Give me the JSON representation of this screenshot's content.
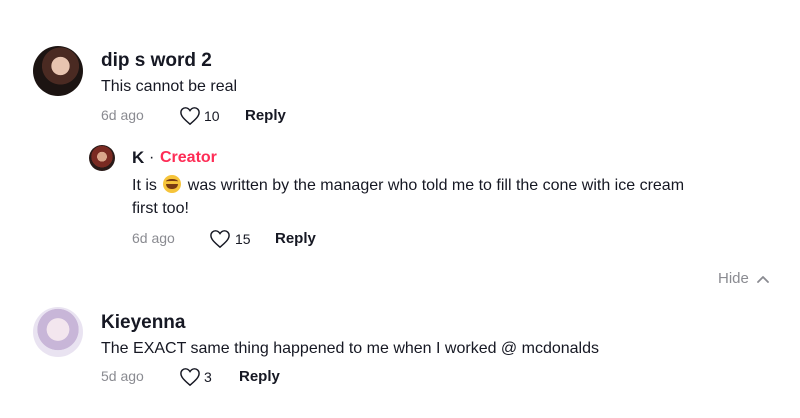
{
  "comments": [
    {
      "username": "dip s word 2",
      "text": "This cannot be real",
      "time": "6d ago",
      "likes": "10",
      "reply_label": "Reply"
    },
    {
      "username": "K",
      "separator": "·",
      "badge": "Creator",
      "text_before_emoji": "It is",
      "emoji_name": "laughing-tears-emoji",
      "text_after_emoji": "was written by the manager who told me to fill the cone with ice cream",
      "text_line2": "first too!",
      "time": "6d ago",
      "likes": "15",
      "reply_label": "Reply"
    },
    {
      "username": "Kieyenna",
      "text": "The EXACT same thing happened to me when I worked @ mcdonalds",
      "time": "5d ago",
      "likes": "3",
      "reply_label": "Reply"
    }
  ],
  "replies_toggle": {
    "label": "Hide",
    "icon": "chevron-up-icon"
  },
  "colors": {
    "creator_badge": "#fe2c55",
    "meta_gray": "#8a8b91",
    "text": "#161823"
  }
}
